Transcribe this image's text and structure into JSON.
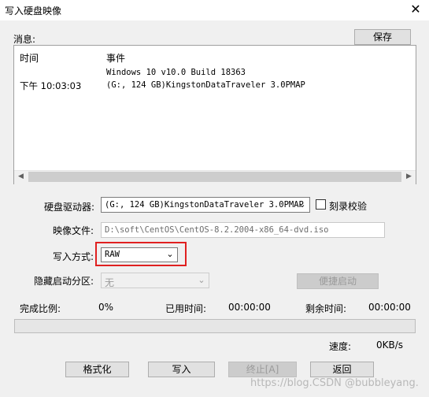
{
  "window": {
    "title": "写入硬盘映像",
    "close_glyph": "✕"
  },
  "messages": {
    "label": "消息:",
    "save_button": "保存",
    "col_time": "时间",
    "col_event": "事件",
    "entries": [
      {
        "time": "",
        "event": "Windows 10 v10.0 Build 18363"
      },
      {
        "time": "下午 10:03:03",
        "event": "(G:, 124 GB)KingstonDataTraveler 3.0PMAP"
      }
    ]
  },
  "form": {
    "drive_label": "硬盘驱动器:",
    "drive_value": "(G:, 124 GB)KingstonDataTraveler 3.0PMAP",
    "verify_label": "刻录校验",
    "verify_checked": false,
    "image_label": "映像文件:",
    "image_value": "D:\\soft\\CentOS\\CentOS-8.2.2004-x86_64-dvd.iso",
    "method_label": "写入方式:",
    "method_value": "RAW",
    "hidden_partition_label": "隐藏启动分区:",
    "hidden_partition_value": "无",
    "quick_boot_button": "便捷启动"
  },
  "progress": {
    "percent_label": "完成比例:",
    "percent_value": "0%",
    "elapsed_label": "已用时间:",
    "elapsed_value": "00:00:00",
    "remaining_label": "剩余时间:",
    "remaining_value": "00:00:00",
    "fraction": 0.0,
    "speed_label": "速度:",
    "speed_value": "0KB/s"
  },
  "buttons": {
    "format": "格式化",
    "write": "写入",
    "stop": "终止[A]",
    "back": "返回"
  },
  "watermark": "https://blog.CSDN @bubbleyang.",
  "colors": {
    "highlight_box": "#e02020",
    "progress_fill": "#06b025"
  }
}
